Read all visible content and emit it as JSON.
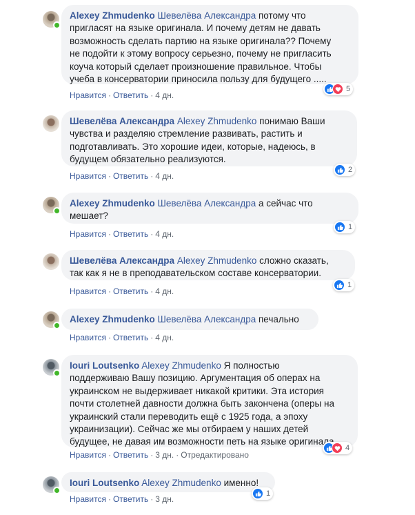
{
  "ui": {
    "like_label": "Нравится",
    "reply_label": "Ответить",
    "edited_label": "Отредактировано"
  },
  "comments": [
    {
      "author": "Alexey Zhmudenko",
      "mention": "Шевелёва Александра",
      "lines": [
        " потому что",
        "пригласят на языке оригинала. И почему детям не давать",
        "возможность сделать партию на языке оригинала?? Почему",
        "не подойти к этому вопросу серьезно, почему не пригласить",
        "коуча который сделает произношение правильное. Чтобы",
        "учеба в консерватории приносила пользу для будущего ....."
      ],
      "time": "4 дн.",
      "reactions": "5"
    },
    {
      "author": "Шевелёва Александра",
      "mention": "Alexey Zhmudenko",
      "lines": [
        " понимаю Ваши",
        "чувства и разделяю стремление развивать, растить и",
        "подготавливать. Это хорошие идеи, которые, надеюсь, в",
        "будущем обязательно реализуются."
      ],
      "time": "4 дн.",
      "reactions": "2"
    },
    {
      "author": "Alexey Zhmudenko",
      "mention": "Шевелёва Александра",
      "lines": [
        " а сейчас что",
        "мешает?"
      ],
      "time": "4 дн.",
      "reactions": "1"
    },
    {
      "author": "Шевелёва Александра",
      "mention": "Alexey Zhmudenko",
      "lines": [
        " сложно сказать,",
        "так как я не в преподавательском составе консерватории."
      ],
      "time": "4 дн.",
      "reactions": "1"
    },
    {
      "author": "Alexey Zhmudenko",
      "mention": "Шевелёва Александра",
      "lines": [
        " печально"
      ],
      "time": "4 дн."
    },
    {
      "author": "Iouri Loutsenko",
      "mention": "Alexey Zhmudenko",
      "lines": [
        " Я полностью",
        "поддерживаю Вашу позицию. Аргументация об операх на",
        "украинском не выдерживает никакой критики. Эта история",
        "почти столетней давности должна быть закончена (оперы на",
        "украинский стали переводить ещё с 1925 года, а эпоху",
        "украинизации). Сейчас же мы отбираем у наших детей",
        "будущее, не давая им возможности петь на языке оригинала"
      ],
      "time": "3 дн.",
      "reactions": "4"
    },
    {
      "author": "Iouri Loutsenko",
      "mention": "Alexey Zhmudenko",
      "lines": [
        " именно!"
      ],
      "time": "3 дн.",
      "reactions": "1"
    }
  ]
}
